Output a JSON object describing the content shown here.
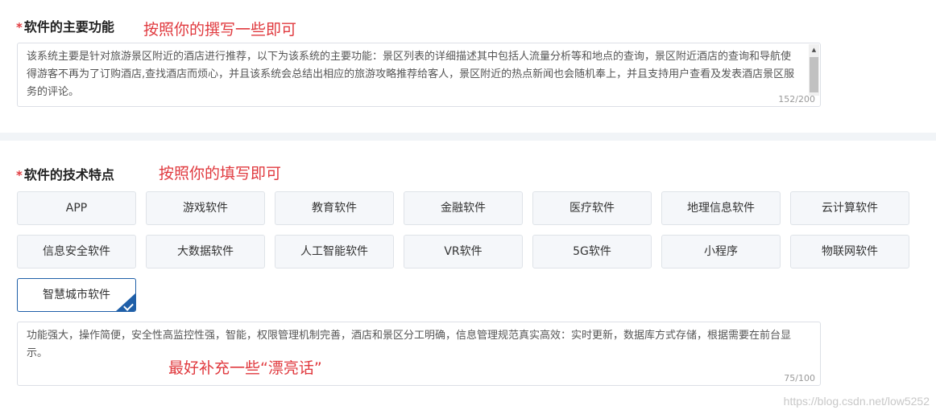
{
  "main_function": {
    "label": "软件的主要功能",
    "annotation": "按照你的撰写一些即可",
    "text": "该系统主要是针对旅游景区附近的酒店进行推荐，以下为该系统的主要功能：景区列表的详细描述其中包括人流量分析等和地点的查询，景区附近酒店的查询和导航使得游客不再为了订购酒店,查找酒店而烦心，并且该系统会总结出相应的旅游攻略推荐给客人，景区附近的热点新闻也会随机奉上，并且支持用户查看及发表酒店景区服务的评论。",
    "counter": "152/200"
  },
  "tech_features": {
    "label": "软件的技术特点",
    "annotation": "按照你的填写即可",
    "tags": [
      {
        "label": "APP",
        "selected": false
      },
      {
        "label": "游戏软件",
        "selected": false
      },
      {
        "label": "教育软件",
        "selected": false
      },
      {
        "label": "金融软件",
        "selected": false
      },
      {
        "label": "医疗软件",
        "selected": false
      },
      {
        "label": "地理信息软件",
        "selected": false
      },
      {
        "label": "云计算软件",
        "selected": false
      },
      {
        "label": "信息安全软件",
        "selected": false
      },
      {
        "label": "大数据软件",
        "selected": false
      },
      {
        "label": "人工智能软件",
        "selected": false
      },
      {
        "label": "VR软件",
        "selected": false
      },
      {
        "label": "5G软件",
        "selected": false
      },
      {
        "label": "小程序",
        "selected": false
      },
      {
        "label": "物联网软件",
        "selected": false
      },
      {
        "label": "智慧城市软件",
        "selected": true
      }
    ],
    "text": "功能强大，操作简便，安全性高监控性强，智能，权限管理机制完善，酒店和景区分工明确，信息管理规范真实高效：实时更新，数据库方式存储，根据需要在前台显示。",
    "annotation_2": "最好补充一些“漂亮话”",
    "counter": "75/100"
  },
  "required_mark": "*",
  "watermark": "https://blog.csdn.net/low5252",
  "colors": {
    "required": "#e0393e",
    "annotation": "#e0393e",
    "selected_border": "#1f5fa8",
    "tag_bg": "#f5f7fa"
  }
}
